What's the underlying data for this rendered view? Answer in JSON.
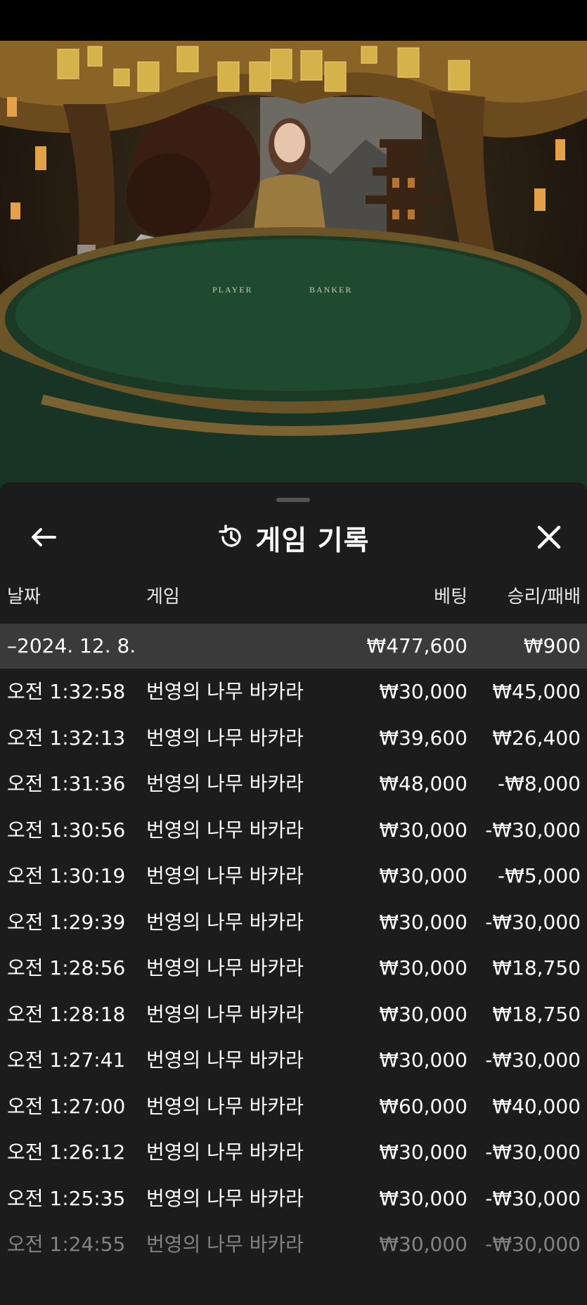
{
  "stream": {
    "table_label_left": "PLAYER",
    "table_label_right": "BANKER"
  },
  "history": {
    "title": "게임 기록",
    "back_icon": "arrow-left-icon",
    "history_icon": "history-clock-icon",
    "close_icon": "close-x-icon",
    "columns": {
      "date": "날짜",
      "game": "게임",
      "bet": "베팅",
      "win_loss": "승리/패배"
    },
    "day_group": {
      "date": "–2024. 12. 8.",
      "bet_total": "₩477,600",
      "win_loss_total": "₩900"
    },
    "rows": [
      {
        "time": "오전 1:32:58",
        "game": "번영의 나무 바카라",
        "bet": "₩30,000",
        "result": "₩45,000"
      },
      {
        "time": "오전 1:32:13",
        "game": "번영의 나무 바카라",
        "bet": "₩39,600",
        "result": "₩26,400"
      },
      {
        "time": "오전 1:31:36",
        "game": "번영의 나무 바카라",
        "bet": "₩48,000",
        "result": "-₩8,000"
      },
      {
        "time": "오전 1:30:56",
        "game": "번영의 나무 바카라",
        "bet": "₩30,000",
        "result": "-₩30,000"
      },
      {
        "time": "오전 1:30:19",
        "game": "번영의 나무 바카라",
        "bet": "₩30,000",
        "result": "-₩5,000"
      },
      {
        "time": "오전 1:29:39",
        "game": "번영의 나무 바카라",
        "bet": "₩30,000",
        "result": "-₩30,000"
      },
      {
        "time": "오전 1:28:56",
        "game": "번영의 나무 바카라",
        "bet": "₩30,000",
        "result": "₩18,750"
      },
      {
        "time": "오전 1:28:18",
        "game": "번영의 나무 바카라",
        "bet": "₩30,000",
        "result": "₩18,750"
      },
      {
        "time": "오전 1:27:41",
        "game": "번영의 나무 바카라",
        "bet": "₩30,000",
        "result": "-₩30,000"
      },
      {
        "time": "오전 1:27:00",
        "game": "번영의 나무 바카라",
        "bet": "₩60,000",
        "result": "₩40,000"
      },
      {
        "time": "오전 1:26:12",
        "game": "번영의 나무 바카라",
        "bet": "₩30,000",
        "result": "-₩30,000"
      },
      {
        "time": "오전 1:25:35",
        "game": "번영의 나무 바카라",
        "bet": "₩30,000",
        "result": "-₩30,000"
      },
      {
        "time": "오전 1:24:55",
        "game": "번영의 나무 바카라",
        "bet": "₩30,000",
        "result": "-₩30,000"
      }
    ]
  }
}
